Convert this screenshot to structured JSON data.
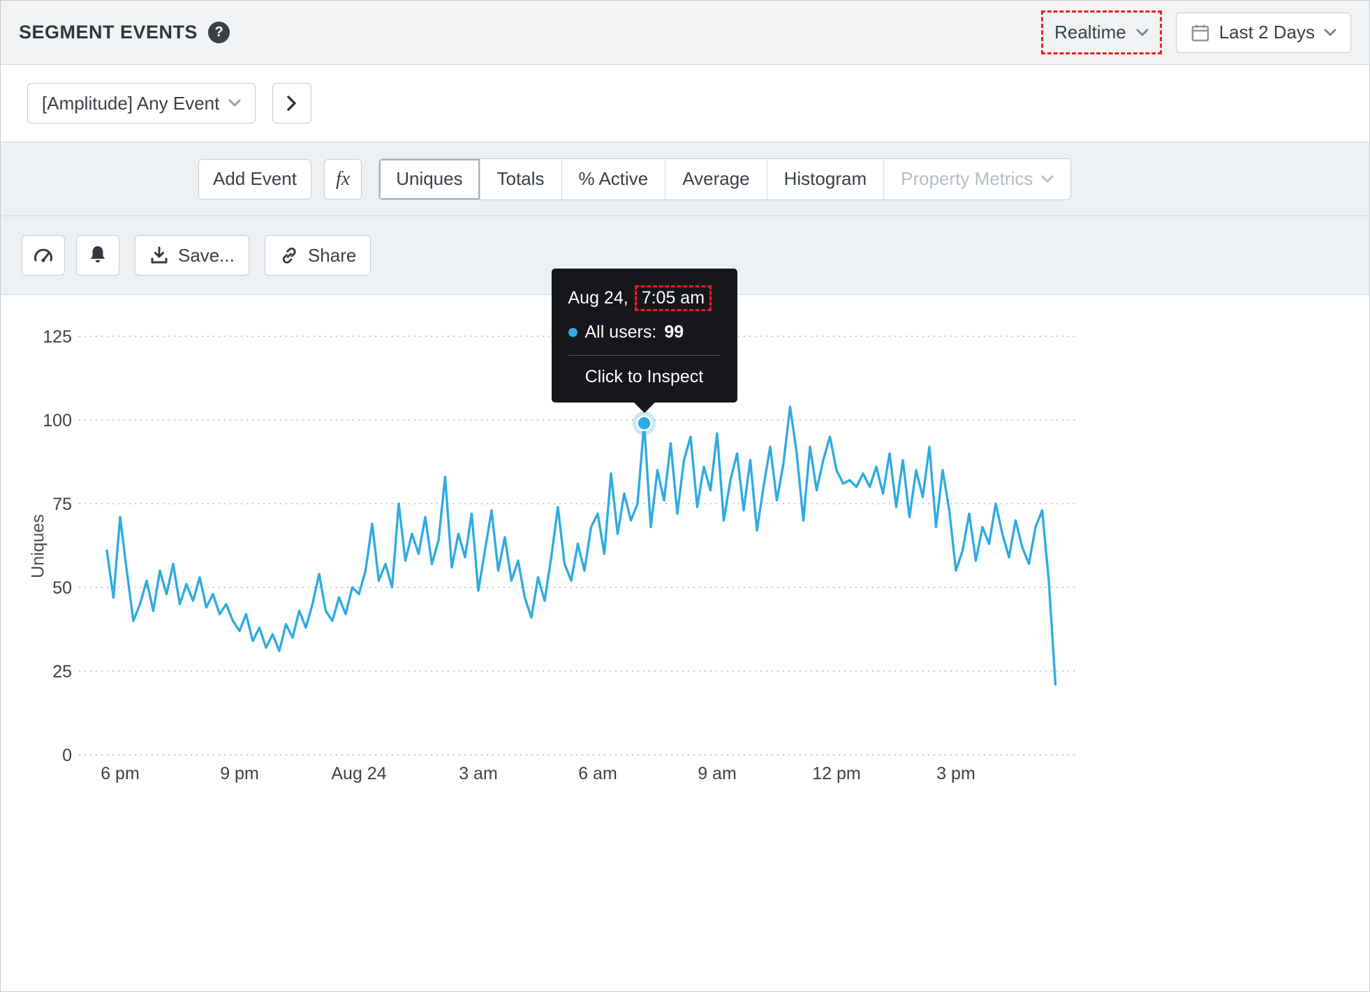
{
  "header": {
    "title": "SEGMENT EVENTS",
    "help_glyph": "?",
    "realtime_label": "Realtime",
    "date_range_label": "Last 2 Days"
  },
  "event_bar": {
    "event_selector_label": "[Amplitude] Any Event"
  },
  "metric_bar": {
    "add_event_label": "Add Event",
    "formula_label": "fx",
    "tabs": [
      {
        "label": "Uniques",
        "selected": true,
        "disabled": false
      },
      {
        "label": "Totals",
        "selected": false,
        "disabled": false
      },
      {
        "label": "% Active",
        "selected": false,
        "disabled": false
      },
      {
        "label": "Average",
        "selected": false,
        "disabled": false
      },
      {
        "label": "Histogram",
        "selected": false,
        "disabled": false
      },
      {
        "label": "Property Metrics",
        "selected": false,
        "disabled": true
      }
    ]
  },
  "toolbar": {
    "save_label": "Save...",
    "share_label": "Share"
  },
  "tooltip": {
    "date_prefix": "Aug 24,",
    "time": "7:05 am",
    "series_label": "All users:",
    "value": "99",
    "action": "Click to Inspect"
  },
  "colors": {
    "accent_blue": "#2fabe1",
    "annotation_red": "#ee1d23",
    "tooltip_bg": "#15171a"
  },
  "chart_data": {
    "type": "line",
    "title": "",
    "ylabel": "Uniques",
    "xlabel": "",
    "ylim": [
      0,
      125
    ],
    "yticks": [
      0,
      25,
      50,
      75,
      100,
      125
    ],
    "xticks": [
      {
        "label": "6 pm",
        "hour": 18
      },
      {
        "label": "9 pm",
        "hour": 21
      },
      {
        "label": "Aug 24",
        "hour": 24
      },
      {
        "label": "3 am",
        "hour": 27
      },
      {
        "label": "6 am",
        "hour": 30
      },
      {
        "label": "9 am",
        "hour": 33
      },
      {
        "label": "12 pm",
        "hour": 36
      },
      {
        "label": "3 pm",
        "hour": 39
      }
    ],
    "x_start_hour": 17.6667,
    "x_step_hours": 0.166667,
    "x_axis_note": "hours, 24 = midnight Aug 24; points every 10 min (realtime)",
    "grid": "dotted horizontal",
    "legend": "none",
    "series": [
      {
        "name": "All users",
        "color": "#2fabe1",
        "values": [
          61,
          47,
          71,
          55,
          40,
          45,
          52,
          43,
          55,
          48,
          57,
          45,
          51,
          46,
          53,
          44,
          48,
          42,
          45,
          40,
          37,
          42,
          34,
          38,
          32,
          36,
          31,
          39,
          35,
          43,
          38,
          45,
          54,
          43,
          40,
          47,
          42,
          50,
          48,
          55,
          69,
          52,
          57,
          50,
          75,
          58,
          66,
          60,
          71,
          57,
          64,
          83,
          56,
          66,
          59,
          72,
          49,
          61,
          73,
          55,
          65,
          52,
          58,
          47,
          41,
          53,
          46,
          59,
          74,
          57,
          52,
          63,
          55,
          68,
          72,
          60,
          84,
          66,
          78,
          70,
          75,
          99,
          68,
          85,
          76,
          93,
          72,
          88,
          95,
          74,
          86,
          79,
          96,
          70,
          82,
          90,
          73,
          88,
          67,
          80,
          92,
          76,
          87,
          104,
          90,
          70,
          92,
          79,
          88,
          95,
          85,
          81,
          82,
          80,
          84,
          80,
          86,
          78,
          90,
          74,
          88,
          71,
          85,
          77,
          92,
          68,
          85,
          73,
          55,
          61,
          72,
          58,
          68,
          63,
          75,
          66,
          59,
          70,
          62,
          57,
          68,
          73,
          52,
          21
        ]
      }
    ],
    "highlight": {
      "index": 81,
      "value": 99,
      "time_label": "Aug 24, 7:05 am"
    }
  }
}
